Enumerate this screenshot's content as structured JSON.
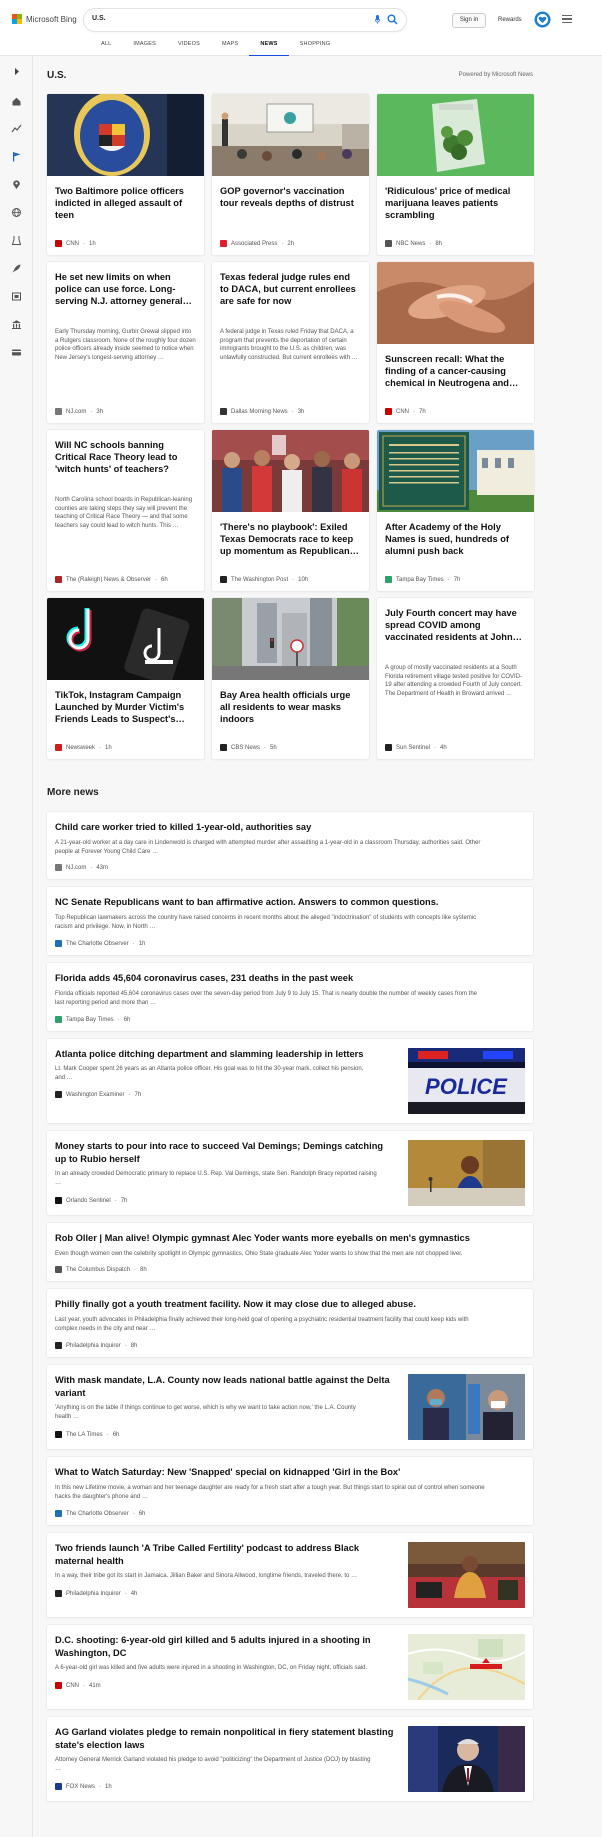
{
  "header": {
    "logo_text": "Microsoft Bing",
    "search_value": "U.S.",
    "signin_label": "Sign in",
    "rewards_label": "Rewards"
  },
  "tabs": [
    "ALL",
    "IMAGES",
    "VIDEOS",
    "MAPS",
    "NEWS",
    "SHOPPING"
  ],
  "active_tab": "NEWS",
  "section": {
    "title": "U.S.",
    "powered_by": "Powered by Microsoft News"
  },
  "cards": [
    {
      "title": "Two Baltimore police officers indicted in alleged assault of teen",
      "snippet": "",
      "source": "CNN",
      "time": "1h",
      "src_color": "#cc0000"
    },
    {
      "title": "GOP governor's vaccination tour reveals depths of distrust",
      "snippet": "",
      "source": "Associated Press",
      "time": "2h",
      "src_color": "#e21c2a"
    },
    {
      "title": "'Ridiculous' price of medical marijuana leaves patients scrambling",
      "snippet": "",
      "source": "NBC News",
      "time": "8h",
      "src_color": "#555555"
    },
    {
      "title": "He set new limits on when police can use force. Long-serving N.J. attorney general…",
      "snippet": "Early Thursday morning, Gurbir Grewal slipped into a Rutgers classroom. None of the roughly four dozen police officers already inside seemed to notice when New Jersey's longest-serving attorney …",
      "source": "NJ.com",
      "time": "3h",
      "src_color": "#777777"
    },
    {
      "title": "Texas federal judge rules end to DACA, but current enrollees are safe for now",
      "snippet": "A federal judge in Texas ruled Friday that DACA, a program that prevents the deportation of certain immigrants brought to the U.S. as children, was unlawfully constructed. But current enrollees with …",
      "source": "Dallas Morning News",
      "time": "3h",
      "src_color": "#333333"
    },
    {
      "title": "Sunscreen recall: What the finding of a cancer-causing chemical in Neutrogena and…",
      "snippet": "",
      "source": "CNN",
      "time": "7h",
      "src_color": "#cc0000"
    },
    {
      "title": "Will NC schools banning Critical Race Theory lead to 'witch hunts' of teachers?",
      "snippet": "North Carolina school boards in Republican-leaning counties are taking steps they say will prevent the teaching of Critical Race Theory — and that some teachers say could lead to witch hunts. This …",
      "source": "The (Raleigh) News & Observer",
      "time": "6h",
      "src_color": "#b22222"
    },
    {
      "title": "'There's no playbook': Exiled Texas Democrats race to keep up momentum as Republican…",
      "snippet": "",
      "source": "The Washington Post",
      "time": "10h",
      "src_color": "#222222"
    },
    {
      "title": "After Academy of the Holy Names is sued, hundreds of alumni push back",
      "snippet": "",
      "source": "Tampa Bay Times",
      "time": "7h",
      "src_color": "#2ba36a"
    },
    {
      "title": "TikTok, Instagram Campaign Launched by Murder Victim's Friends Leads to Suspect's…",
      "snippet": "",
      "source": "Newsweek",
      "time": "1h",
      "src_color": "#d61b1b"
    },
    {
      "title": "Bay Area health officials urge all residents to wear masks indoors",
      "snippet": "",
      "source": "CBS News",
      "time": "5h",
      "src_color": "#222222"
    },
    {
      "title": "July Fourth concert may have spread COVID among vaccinated residents at John…",
      "snippet": "A group of mostly vaccinated residents at a South Florida retirement village tested positive for COVID-19 after attending a crowded Fourth of July concert. The Department of Health in Broward arrived …",
      "source": "Sun Sentinel",
      "time": "4h",
      "src_color": "#222222"
    }
  ],
  "more_news_title": "More news",
  "more_news": [
    {
      "title": "Child care worker tried to killed 1-year-old, authorities say",
      "snippet": [
        "A 21-year-old worker at a day care in Lindenwold is charged with attempted murder after assaulting a 1-year-old in a classroom Thursday, authorities said. Other",
        "people at Forever Young Child Care …"
      ],
      "source": "NJ.com",
      "time": "43m",
      "src_color": "#777777",
      "thumb": ""
    },
    {
      "title": "NC Senate Republicans want to ban affirmative action. Answers to common questions.",
      "snippet": [
        "Top Republican lawmakers across the country have raised concerns in recent months about the alleged \"indoctrination\" of students with concepts like systemic",
        "racism and privilege. Now, in North …"
      ],
      "source": "The Charlotte Observer",
      "time": "1h",
      "src_color": "#1e6fb8",
      "thumb": ""
    },
    {
      "title": "Florida adds 45,604 coronavirus cases, 231 deaths in the past week",
      "snippet": [
        "Florida officials reported 45,604 coronavirus cases over the seven-day period from July 9 to July 15. That is nearly double the number of weekly cases from the",
        "last reporting period and more than …"
      ],
      "source": "Tampa Bay Times",
      "time": "6h",
      "src_color": "#2ba36a",
      "thumb": ""
    },
    {
      "title": "Atlanta police ditching department and slamming leadership in letters",
      "snippet": [
        "Lt. Mark Cooper spent 26 years as an Atlanta police officer. His goal was to hit the 30-year mark, collect his pension,",
        "and …"
      ],
      "source": "Washington Examiner",
      "time": "7h",
      "src_color": "#222222",
      "thumb": "police",
      "thumb_text": "POLICE"
    },
    {
      "title": "Money starts to pour into race to succeed Val Demings; Demings catching up to Rubio herself",
      "snippet": [
        "In an already crowded Democratic primary to replace U.S. Rep. Val Demings, state Sen. Randolph Bracy reported raising",
        "…"
      ],
      "source": "Orlando Sentinel",
      "time": "7h",
      "src_color": "#111111",
      "thumb": "demings"
    },
    {
      "title": "Rob Oller | Man alive! Olympic gymnast Alec Yoder wants more eyeballs on men's gymnastics",
      "snippet": [
        "Even though women own the celebrity spotlight in Olympic gymnastics, Ohio State graduate Alec Yoder wants to show that the men are not chopped liver."
      ],
      "source": "The Columbus Dispatch",
      "time": "8h",
      "src_color": "#555555",
      "thumb": ""
    },
    {
      "title": "Philly finally got a youth treatment facility. Now it may close due to alleged abuse.",
      "snippet": [
        "Last year, youth advocates in Philadelphia finally achieved their long-held goal of opening a psychiatric residential treatment facility that could keep kids with",
        "complex needs in the city and near …"
      ],
      "source": "Philadelphia Inquirer",
      "time": "8h",
      "src_color": "#222222",
      "thumb": ""
    },
    {
      "title": "With mask mandate, L.A. County now leads national battle against the Delta variant",
      "snippet": [
        "'Anything is on the table if things continue to get worse, which is why we want to take action now,' the L.A. County",
        "health …"
      ],
      "source": "The LA Times",
      "time": "6h",
      "src_color": "#111111",
      "thumb": "mask"
    },
    {
      "title": "What to Watch Saturday: New 'Snapped' special on kidnapped 'Girl in the Box'",
      "snippet": [
        "In this new Lifetime movie, a woman and her teenage daughter are ready for a fresh start after a tough year. But things start to spiral out of control when someone",
        "hacks the daughter's phone and …"
      ],
      "source": "The Charlotte Observer",
      "time": "6h",
      "src_color": "#1e6fb8",
      "thumb": ""
    },
    {
      "title": "Two friends launch 'A Tribe Called Fertility' podcast to address Black maternal health",
      "snippet": [
        "In a way, their tribe got its start in Jamaica. Jillian Baker and Sinora Allwood, longtime friends, traveled there, to …"
      ],
      "source": "Philadelphia Inquirer",
      "time": "4h",
      "src_color": "#222222",
      "thumb": "podcast"
    },
    {
      "title": "D.C. shooting: 6-year-old girl killed and 5 adults injured in a shooting in Washington, DC",
      "snippet": [
        "A 6-year-old girl was killed and five adults were injured in a shooting in Washington, DC, on Friday night, officials said."
      ],
      "source": "CNN",
      "time": "41m",
      "src_color": "#cc0000",
      "thumb": "map"
    },
    {
      "title": "AG Garland violates pledge to remain nonpolitical in fiery statement blasting state's election laws",
      "snippet": [
        "Attorney General Merrick Garland violated his pledge to avoid \"politicizing\" the Department of Justice (DOJ) by blasting",
        "…"
      ],
      "source": "FOX News",
      "time": "1h",
      "src_color": "#1a3a8a",
      "thumb": "garland"
    }
  ]
}
